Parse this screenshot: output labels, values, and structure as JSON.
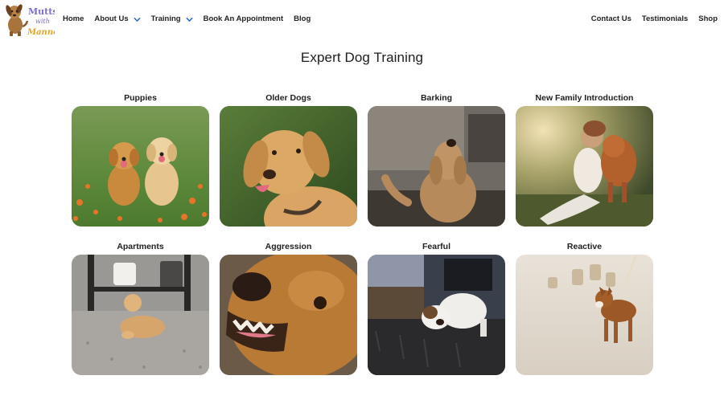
{
  "header": {
    "logo": {
      "word1": "Mutts",
      "word2": "with",
      "word3": "Manners"
    },
    "nav_left": [
      {
        "label": "Home",
        "dropdown": false
      },
      {
        "label": "About Us",
        "dropdown": true
      },
      {
        "label": "Training",
        "dropdown": true
      },
      {
        "label": "Book An Appointment",
        "dropdown": false
      },
      {
        "label": "Blog",
        "dropdown": false
      }
    ],
    "nav_right": [
      {
        "label": "Contact Us"
      },
      {
        "label": "Testimonials"
      },
      {
        "label": "Shop"
      }
    ],
    "accent_color": "#2b6cd8"
  },
  "main": {
    "title": "Expert Dog Training",
    "cards": [
      {
        "title": "Puppies"
      },
      {
        "title": "Older Dogs"
      },
      {
        "title": "Barking"
      },
      {
        "title": "New Family Introduction"
      },
      {
        "title": "Apartments"
      },
      {
        "title": "Aggression"
      },
      {
        "title": "Fearful"
      },
      {
        "title": "Reactive"
      }
    ]
  }
}
